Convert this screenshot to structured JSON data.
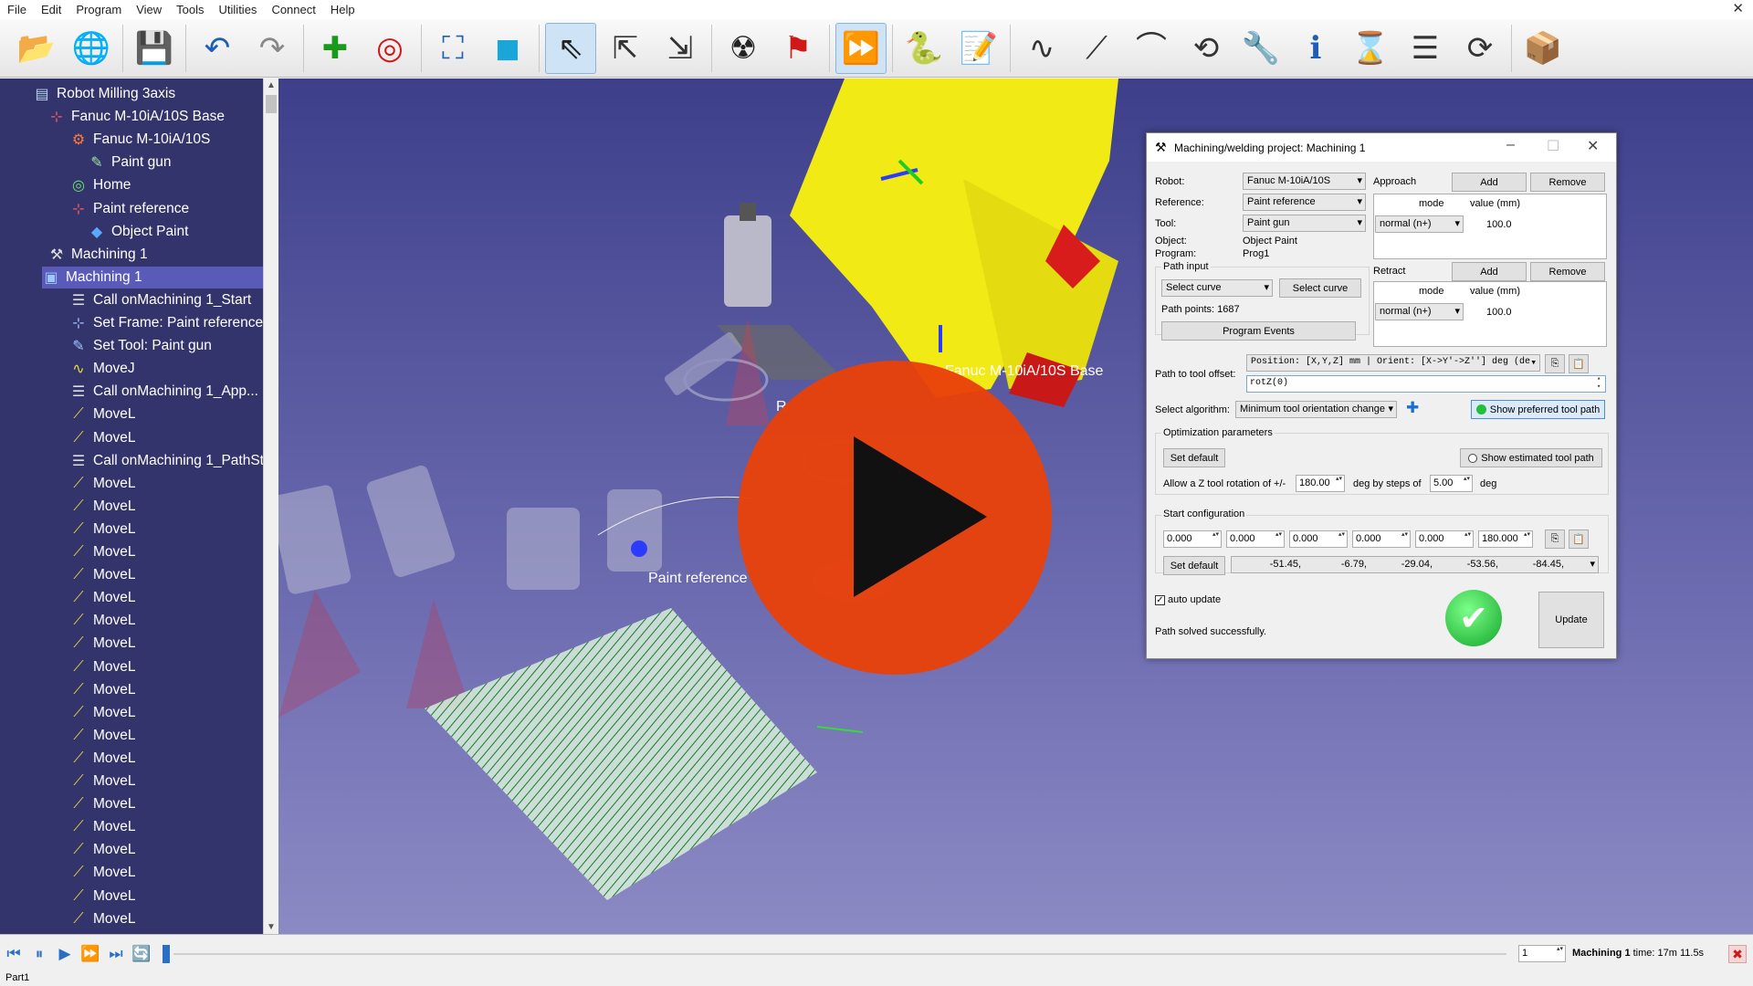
{
  "menu": [
    "File",
    "Edit",
    "Program",
    "View",
    "Tools",
    "Utilities",
    "Connect",
    "Help"
  ],
  "toolbar_icons": [
    "open-icon",
    "web-icon",
    "save-icon",
    "undo-icon",
    "redo-icon",
    "add-frame-icon",
    "add-target-icon",
    "fit-all-icon",
    "cube-view-icon",
    "select-icon",
    "move-frame-icon",
    "move-object-icon",
    "collision-icon",
    "flag-icon",
    "fast-simulation-icon",
    "python-icon",
    "add-program-icon",
    "movej-icon",
    "movel-icon",
    "movec-icon",
    "set-frame-icon",
    "set-tool-icon",
    "info-icon",
    "pause-icon",
    "program-instruction-icon",
    "refresh-icon",
    "package-icon"
  ],
  "tree": {
    "items": [
      {
        "label": "Robot Milling 3axis",
        "icon": "station-icon"
      },
      {
        "label": "Fanuc M-10iA/10S Base",
        "icon": "frame-icon"
      },
      {
        "label": "Fanuc M-10iA/10S",
        "icon": "robot-icon"
      },
      {
        "label": "Paint gun",
        "icon": "tool-icon"
      },
      {
        "label": "Home",
        "icon": "target-icon"
      },
      {
        "label": "Paint reference",
        "icon": "frame-icon"
      },
      {
        "label": "Object Paint",
        "icon": "object-icon"
      },
      {
        "label": "Machining 1",
        "icon": "machining-icon"
      },
      {
        "label": "Machining 1",
        "icon": "program-icon"
      },
      {
        "label": "Call onMachining 1_Start",
        "icon": "call-icon"
      },
      {
        "label": "Set Frame: Paint reference",
        "icon": "set-frame-icon"
      },
      {
        "label": "Set Tool: Paint gun",
        "icon": "set-tool-icon"
      },
      {
        "label": "MoveJ",
        "icon": "movej-icon"
      },
      {
        "label": "Call onMachining 1_App...",
        "icon": "call-icon"
      },
      {
        "label": "MoveL",
        "icon": "movel-icon"
      },
      {
        "label": "MoveL",
        "icon": "movel-icon"
      },
      {
        "label": "Call onMachining 1_PathSt",
        "icon": "call-icon"
      },
      {
        "label": "MoveL",
        "icon": "movel-icon"
      },
      {
        "label": "MoveL",
        "icon": "movel-icon"
      },
      {
        "label": "MoveL",
        "icon": "movel-icon"
      },
      {
        "label": "MoveL",
        "icon": "movel-icon"
      },
      {
        "label": "MoveL",
        "icon": "movel-icon"
      },
      {
        "label": "MoveL",
        "icon": "movel-icon"
      },
      {
        "label": "MoveL",
        "icon": "movel-icon"
      },
      {
        "label": "MoveL",
        "icon": "movel-icon"
      },
      {
        "label": "MoveL",
        "icon": "movel-icon"
      },
      {
        "label": "MoveL",
        "icon": "movel-icon"
      },
      {
        "label": "MoveL",
        "icon": "movel-icon"
      },
      {
        "label": "MoveL",
        "icon": "movel-icon"
      },
      {
        "label": "MoveL",
        "icon": "movel-icon"
      },
      {
        "label": "MoveL",
        "icon": "movel-icon"
      },
      {
        "label": "MoveL",
        "icon": "movel-icon"
      },
      {
        "label": "MoveL",
        "icon": "movel-icon"
      },
      {
        "label": "MoveL",
        "icon": "movel-icon"
      },
      {
        "label": "MoveL",
        "icon": "movel-icon"
      },
      {
        "label": "MoveL",
        "icon": "movel-icon"
      },
      {
        "label": "MoveL",
        "icon": "movel-icon"
      }
    ]
  },
  "viewport": {
    "label_base": "Fanuc M-10iA/10S Base",
    "label_ref": "Paint reference",
    "label_cut": "R"
  },
  "dialog": {
    "title": "Machining/welding project: Machining 1",
    "robot_label": "Robot:",
    "robot_value": "Fanuc M-10iA/10S",
    "reference_label": "Reference:",
    "reference_value": "Paint reference",
    "tool_label": "Tool:",
    "tool_value": "Paint gun",
    "object_label": "Object:",
    "object_value": "Object Paint",
    "program_label": "Program:",
    "program_value": "Prog1",
    "path_input_title": "Path input",
    "path_input_value": "Select curve",
    "select_curve_button": "Select curve",
    "path_points": "Path points: 1687",
    "program_events_button": "Program Events",
    "approach_label": "Approach",
    "retract_label": "Retract",
    "add_button": "Add",
    "remove_button": "Remove",
    "col_mode": "mode",
    "col_value": "value (mm)",
    "approach_mode": "normal (n+)",
    "approach_value": "100.0",
    "retract_mode": "normal (n+)",
    "retract_value": "100.0",
    "path_offset_label": "Path to tool offset:",
    "path_offset_value": "Position: [X,Y,Z] mm | Orient: [X->Y'->Z''] deg (de",
    "path_offset_input": "rotZ(0)",
    "algorithm_label": "Select algorithm:",
    "algorithm_value": "Minimum tool orientation change",
    "show_preferred_button": "Show preferred tool path",
    "optimization_title": "Optimization parameters",
    "set_default_button": "Set default",
    "show_estimated_label": "Show estimated tool path",
    "allow_rotation_label": "Allow a Z tool rotation of +/-",
    "rotation_value": "180.00",
    "steps_label": "deg by steps of",
    "steps_value": "5.00",
    "deg_label": "deg",
    "start_config_title": "Start configuration",
    "config_values": [
      "0.000",
      "0.000",
      "0.000",
      "0.000",
      "0.000",
      "180.000"
    ],
    "config_default_button": "Set default",
    "config_readout": [
      "-51.45,",
      "-6.79,",
      "-29.04,",
      "-53.56,",
      "-84.45,"
    ],
    "auto_update_label": "auto update",
    "status_text": "Path solved successfully.",
    "update_button": "Update"
  },
  "bottom": {
    "speed_value": "1",
    "time_prefix": "Machining 1",
    "time_text": " time: 17m 11.5s"
  },
  "status": {
    "text": "Part1"
  },
  "colors": {
    "tree_bg": "#34346d",
    "play": "#e8410a",
    "success": "#22c03a"
  }
}
